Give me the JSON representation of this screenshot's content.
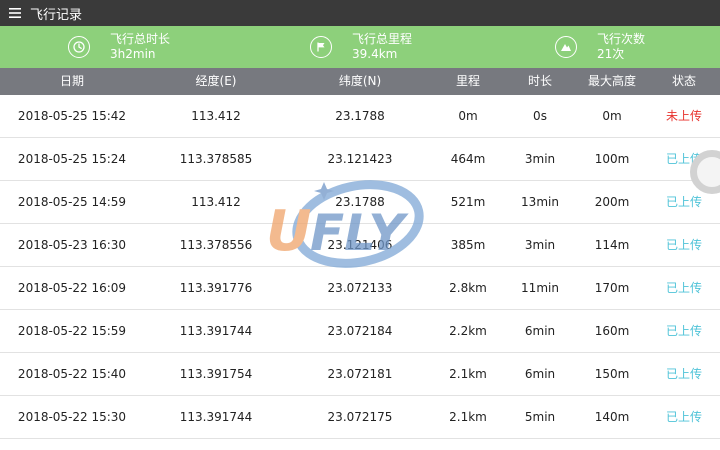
{
  "app": {
    "title": "飞行记录",
    "menu_icon": "menu-icon"
  },
  "stats": [
    {
      "icon": "clock-icon",
      "label": "飞行总时长",
      "value": "3h2min"
    },
    {
      "icon": "flag-icon",
      "label": "飞行总里程",
      "value": "39.4km"
    },
    {
      "icon": "mountain-icon",
      "label": "飞行次数",
      "value": "21次"
    }
  ],
  "table": {
    "headers": [
      "日期",
      "经度(E)",
      "纬度(N)",
      "里程",
      "时长",
      "最大高度",
      "状态"
    ],
    "rows": [
      [
        "2018-05-25 15:42",
        "113.412",
        "23.1788",
        "0m",
        "0s",
        "0m",
        "未上传"
      ],
      [
        "2018-05-25 15:24",
        "113.378585",
        "23.121423",
        "464m",
        "3min",
        "100m",
        "已上传"
      ],
      [
        "2018-05-25 14:59",
        "113.412",
        "23.1788",
        "521m",
        "13min",
        "200m",
        "已上传"
      ],
      [
        "2018-05-23 16:30",
        "113.378556",
        "23.121406",
        "385m",
        "3min",
        "114m",
        "已上传"
      ],
      [
        "2018-05-22 16:09",
        "113.391776",
        "23.072133",
        "2.8km",
        "11min",
        "170m",
        "已上传"
      ],
      [
        "2018-05-22 15:59",
        "113.391744",
        "23.072184",
        "2.2km",
        "6min",
        "160m",
        "已上传"
      ],
      [
        "2018-05-22 15:40",
        "113.391754",
        "23.072181",
        "2.1km",
        "6min",
        "150m",
        "已上传"
      ],
      [
        "2018-05-22 15:30",
        "113.391744",
        "23.072175",
        "2.1km",
        "5min",
        "140m",
        "已上传"
      ]
    ]
  },
  "watermark": {
    "text": "UFLY"
  },
  "colors": {
    "topbar": "#3a3a3a",
    "stats_bar": "#8dd07b",
    "table_header": "#77797f",
    "status_pending": "#e8322d",
    "status_done": "#4fc3d8"
  }
}
